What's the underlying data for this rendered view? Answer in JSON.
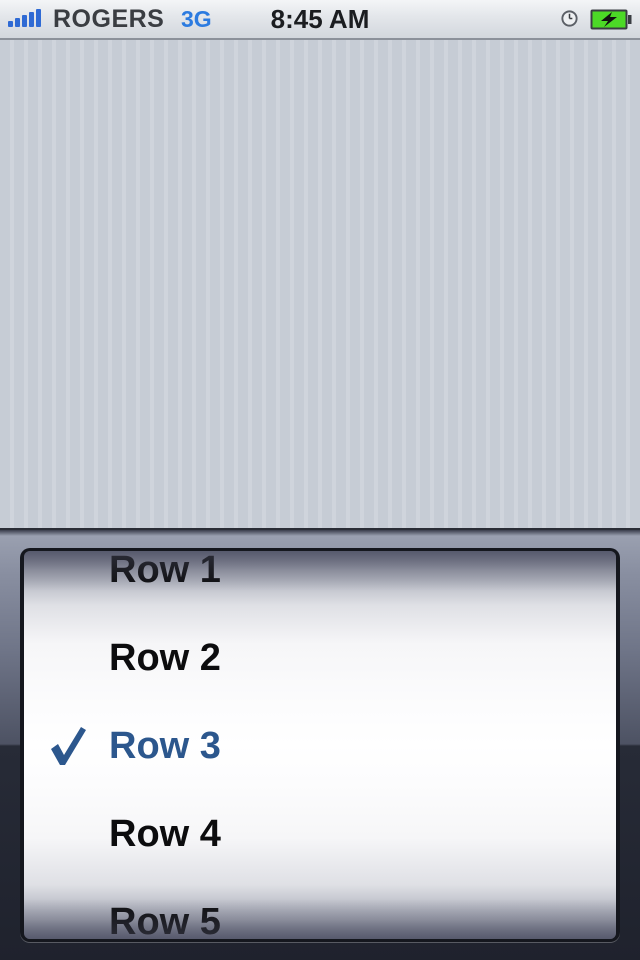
{
  "status_bar": {
    "carrier": "ROGERS",
    "network": "3G",
    "time": "8:45 AM",
    "signal_icon": "signal-strength-icon",
    "alarm_icon": "alarm-clock-icon",
    "battery_icon": "battery-charging-icon"
  },
  "picker": {
    "rows": [
      {
        "label": "Row 1",
        "selected": false
      },
      {
        "label": "Row 2",
        "selected": false
      },
      {
        "label": "Row 3",
        "selected": true
      },
      {
        "label": "Row 4",
        "selected": false
      },
      {
        "label": "Row 5",
        "selected": false
      }
    ],
    "check_icon": "checkmark-icon"
  },
  "colors": {
    "selected_text": "#2c578d",
    "network_text": "#2c7be0",
    "battery_fill": "#4cd926"
  }
}
